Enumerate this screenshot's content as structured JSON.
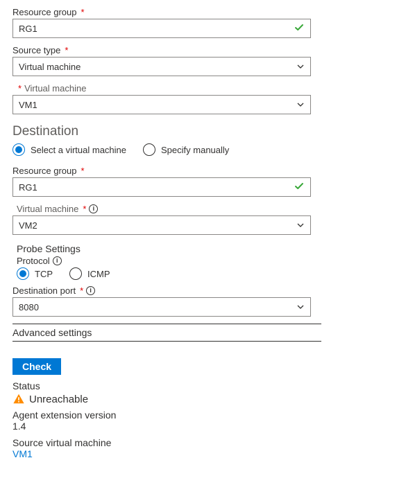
{
  "source": {
    "resource_group_label": "Resource group",
    "resource_group_value": "RG1",
    "source_type_label": "Source type",
    "source_type_value": "Virtual machine",
    "vm_label": "Virtual machine",
    "vm_value": "VM1"
  },
  "destination": {
    "title": "Destination",
    "radio_select_vm": "Select a virtual machine",
    "radio_manual": "Specify manually",
    "selected": "vm",
    "resource_group_label": "Resource group",
    "resource_group_value": "RG1",
    "vm_label": "Virtual machine",
    "vm_value": "VM2"
  },
  "probe": {
    "title": "Probe Settings",
    "protocol_label": "Protocol",
    "tcp": "TCP",
    "icmp": "ICMP",
    "selected": "tcp",
    "port_label": "Destination port",
    "port_value": "8080"
  },
  "advanced_label": "Advanced settings",
  "check_button": "Check",
  "result": {
    "status_label": "Status",
    "status_value": "Unreachable",
    "agent_label": "Agent extension version",
    "agent_value": "1.4",
    "source_vm_label": "Source virtual machine",
    "source_vm_value": "VM1"
  }
}
